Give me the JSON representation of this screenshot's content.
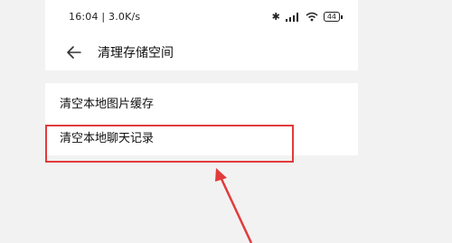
{
  "statusbar": {
    "time_speed": "16:04 | 3.0K/s",
    "battery": "44",
    "icons": [
      "bluetooth-icon",
      "signal-icon",
      "wifi-icon",
      "battery-icon"
    ]
  },
  "header": {
    "title": "清理存储空间",
    "back_icon": "back-arrow-icon"
  },
  "list": {
    "items": [
      {
        "label": "清空本地图片缓存"
      },
      {
        "label": "清空本地聊天记录"
      }
    ]
  },
  "annotation": {
    "highlight_color": "#e23b3b"
  }
}
